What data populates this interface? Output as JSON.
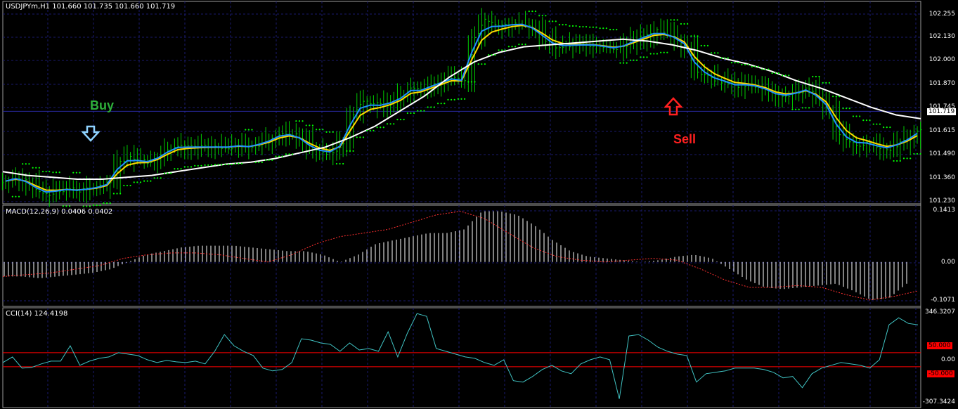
{
  "main": {
    "header": "USDJPYm,H1  101.660 101.735 101.660 101.719",
    "price_ticks": [
      "102.255",
      "102.130",
      "102.000",
      "101.870",
      "101.745",
      "101.615",
      "101.490",
      "101.360",
      "101.230"
    ],
    "current_price": "101.719",
    "buy_label": "Buy",
    "sell_label": "Sell"
  },
  "macd": {
    "header": "MACD(12,26,9) 0.0406 0.0402",
    "ticks": [
      "0.1413",
      "0.00",
      "-0.1071"
    ]
  },
  "cci": {
    "header": "CCI(14) 124.4198",
    "ticks": [
      "346.3207",
      "0.00",
      "-307.3424"
    ],
    "level_up": "50.000",
    "level_down": "-50.000"
  },
  "colors": {
    "candles": "#00cc00",
    "fast_ma": "#1e90ff",
    "slow_ma": "#ffd700",
    "long_ma": "#ffffff",
    "sar": "#00ff00",
    "grid": "#1a1a6e",
    "macd_hist": "#ffffff",
    "macd_signal": "#ff3030",
    "cci_line": "#40c4c4",
    "cci_levels": "#ff0000",
    "buy": "#2eaf3a",
    "sell": "#ff2020"
  },
  "chart_data": [
    {
      "type": "line",
      "name": "USDJPYm H1 price",
      "ylim": [
        101.23,
        102.3
      ],
      "close": [
        101.35,
        101.37,
        101.34,
        101.3,
        101.28,
        101.3,
        101.31,
        101.3,
        101.31,
        101.32,
        101.34,
        101.45,
        101.48,
        101.46,
        101.45,
        101.48,
        101.52,
        101.54,
        101.53,
        101.53,
        101.53,
        101.53,
        101.53,
        101.54,
        101.53,
        101.55,
        101.57,
        101.6,
        101.6,
        101.57,
        101.52,
        101.5,
        101.5,
        101.55,
        101.7,
        101.78,
        101.76,
        101.75,
        101.77,
        101.8,
        101.85,
        101.83,
        101.86,
        101.88,
        101.9,
        101.88,
        102.1,
        102.2,
        102.18,
        102.17,
        102.18,
        102.18,
        102.15,
        102.1,
        102.06,
        102.06,
        102.07,
        102.07,
        102.07,
        102.06,
        102.05,
        102.07,
        102.1,
        102.12,
        102.14,
        102.13,
        102.1,
        102.06,
        101.93,
        101.9,
        101.88,
        101.87,
        101.85,
        101.86,
        101.85,
        101.83,
        101.8,
        101.8,
        101.82,
        101.84,
        101.79,
        101.73,
        101.6,
        101.55,
        101.54,
        101.55,
        101.53,
        101.52,
        101.55,
        101.58,
        101.62
      ],
      "long_ma": [
        101.4,
        101.38,
        101.37,
        101.36,
        101.36,
        101.37,
        101.38,
        101.4,
        101.42,
        101.44,
        101.45,
        101.47,
        101.5,
        101.53,
        101.58,
        101.64,
        101.72,
        101.8,
        101.9,
        101.98,
        102.03,
        102.06,
        102.07,
        102.08,
        102.09,
        102.1,
        102.09,
        102.07,
        102.04,
        102.0,
        101.97,
        101.93,
        101.88,
        101.84,
        101.79,
        101.74,
        101.7,
        101.68
      ]
    },
    {
      "type": "bar",
      "name": "MACD(12,26,9)",
      "ylim": [
        -0.1071,
        0.1413
      ],
      "histogram": [
        -0.04,
        -0.04,
        -0.045,
        -0.04,
        -0.035,
        -0.03,
        -0.02,
        0.0,
        0.02,
        0.03,
        0.04,
        0.045,
        0.045,
        0.045,
        0.04,
        0.035,
        0.03,
        0.03,
        0.02,
        0.0,
        0.02,
        0.05,
        0.06,
        0.07,
        0.08,
        0.08,
        0.09,
        0.14,
        0.14,
        0.13,
        0.1,
        0.06,
        0.03,
        0.015,
        0.01,
        0.005,
        0.0,
        0.005,
        0.015,
        0.02,
        0.01,
        -0.02,
        -0.05,
        -0.07,
        -0.075,
        -0.07,
        -0.065,
        -0.06,
        -0.08,
        -0.105,
        -0.1,
        -0.06
      ],
      "signal": [
        -0.04,
        -0.035,
        -0.03,
        -0.02,
        -0.01,
        0.01,
        0.02,
        0.025,
        0.025,
        0.02,
        0.01,
        0.0,
        0.02,
        0.05,
        0.07,
        0.08,
        0.09,
        0.11,
        0.13,
        0.14,
        0.12,
        0.08,
        0.04,
        0.015,
        0.005,
        0.0,
        0.005,
        0.01,
        0.005,
        -0.02,
        -0.05,
        -0.07,
        -0.07,
        -0.065,
        -0.07,
        -0.09,
        -0.105,
        -0.095,
        -0.08
      ]
    },
    {
      "type": "line",
      "name": "CCI(14)",
      "ylim": [
        -307.3424,
        346.3207
      ],
      "values": [
        -20,
        20,
        -60,
        -55,
        -30,
        -10,
        -10,
        100,
        -40,
        -10,
        10,
        20,
        50,
        40,
        30,
        0,
        -20,
        -5,
        -15,
        -20,
        -10,
        -30,
        60,
        180,
        100,
        60,
        30,
        -60,
        -80,
        -70,
        -20,
        150,
        140,
        120,
        110,
        60,
        120,
        70,
        80,
        60,
        200,
        20,
        190,
        330,
        310,
        80,
        60,
        40,
        20,
        10,
        -20,
        -40,
        0,
        -150,
        -160,
        -120,
        -70,
        -40,
        -80,
        -100,
        -30,
        0,
        20,
        0,
        -280,
        170,
        180,
        140,
        90,
        60,
        40,
        30,
        -160,
        -100,
        -90,
        -80,
        -60,
        -60,
        -60,
        -70,
        -90,
        -130,
        -120,
        -200,
        -100,
        -60,
        -40,
        -20,
        -30,
        -40,
        -60,
        0,
        250,
        300,
        260,
        250
      ]
    }
  ]
}
